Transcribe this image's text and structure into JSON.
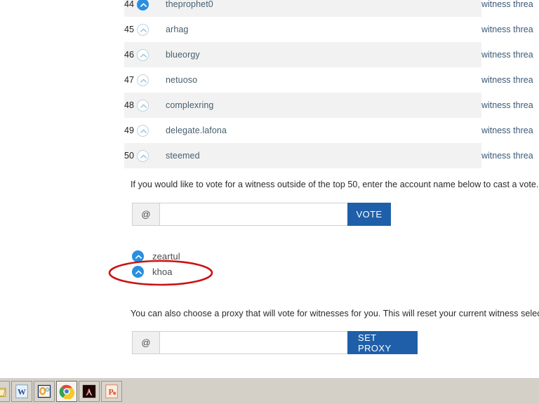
{
  "page": {
    "witness_table": {
      "columns": [
        "rank",
        "upvote",
        "name",
        "thread"
      ],
      "rows": [
        {
          "rank": "44",
          "name": "theprophet0",
          "thread": "witness threa",
          "voted": true,
          "shaded": true
        },
        {
          "rank": "45",
          "name": "arhag",
          "thread": "witness threa",
          "voted": false,
          "shaded": false
        },
        {
          "rank": "46",
          "name": "blueorgy",
          "thread": "witness threa",
          "voted": false,
          "shaded": true
        },
        {
          "rank": "47",
          "name": "netuoso",
          "thread": "witness threa",
          "voted": false,
          "shaded": false
        },
        {
          "rank": "48",
          "name": "complexring",
          "thread": "witness threa",
          "voted": false,
          "shaded": true
        },
        {
          "rank": "49",
          "name": "delegate.lafona",
          "thread": "witness threa",
          "voted": false,
          "shaded": false
        },
        {
          "rank": "50",
          "name": "steemed",
          "thread": "witness threa",
          "voted": false,
          "shaded": true
        }
      ]
    },
    "vote_section": {
      "description": "If you would like to vote for a witness outside of the top 50, enter the account name below to cast a vote.",
      "addon": "@",
      "input_value": "",
      "input_placeholder": "",
      "button_label": "VOTE"
    },
    "selected_witnesses": [
      {
        "name": "zeartul",
        "voted": true
      },
      {
        "name": "khoa",
        "voted": true
      }
    ],
    "proxy_section": {
      "description": "You can also choose a proxy that will vote for witnesses for you. This will reset your current witness selecti",
      "addon": "@",
      "input_value": "",
      "input_placeholder": "",
      "button_label": "SET PROXY"
    },
    "annotation": {
      "shape": "ellipse",
      "color": "#cc1111",
      "target": "khoa"
    },
    "colors": {
      "upvote_active": "#2a8fe0",
      "upvote_inactive_border": "#b9d4e6",
      "button_blue": "#1f5fa9",
      "row_shade": "#f2f2f2",
      "name_text": "#46606f",
      "link_text": "#3b5a78",
      "taskbar": "#d4d0c8",
      "annotation_red": "#cc1111"
    }
  },
  "taskbar": {
    "items": [
      {
        "name": "folder-window",
        "icon": "folder-icon",
        "active": false
      },
      {
        "name": "word-window",
        "icon": "word-icon",
        "active": false
      },
      {
        "name": "outlook-window",
        "icon": "outlook-icon",
        "active": false
      },
      {
        "name": "chrome-window",
        "icon": "chrome-icon",
        "active": true
      },
      {
        "name": "acrobat-window",
        "icon": "acrobat-icon",
        "active": false
      },
      {
        "name": "powerpoint-window",
        "icon": "powerpoint-icon",
        "active": false
      }
    ]
  }
}
